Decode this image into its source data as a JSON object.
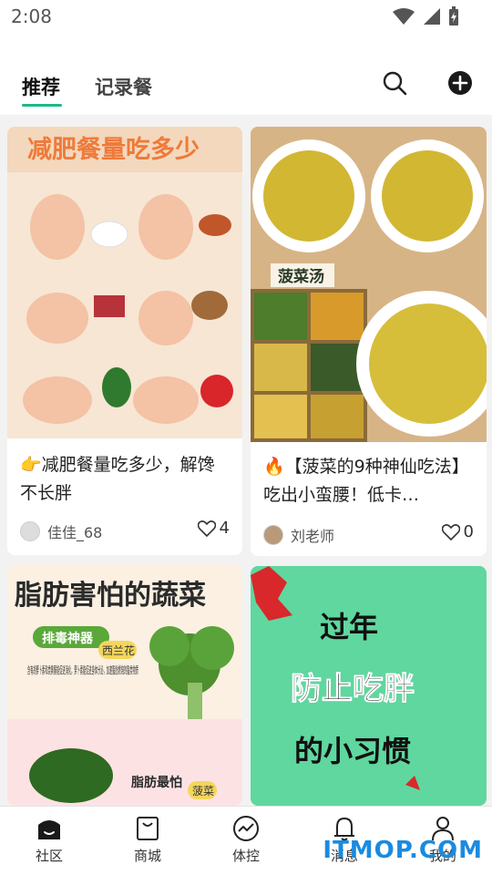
{
  "status": {
    "time": "2:08"
  },
  "tabs": [
    {
      "label": "推荐"
    },
    {
      "label": "记录餐"
    }
  ],
  "header": {
    "search_icon": "search-icon",
    "add_icon": "plus-circle-icon"
  },
  "cards": [
    {
      "image_text": "减肥餐量吃多少",
      "title": "👉减肥餐量吃多少，解馋不长胖",
      "author": "佳佳_68",
      "likes": "4"
    },
    {
      "image_text": "菠菜汤",
      "title": "🔥【菠菜的9种神仙吃法】吃出小蛮腰！低卡…",
      "author": "刘老师",
      "likes": "0"
    },
    {
      "image_text": "脂肪害怕的蔬菜",
      "image_sub": "排毒神器",
      "image_label1": "西兰花",
      "image_desc": "含有胡萝卜素和类黄酮能促进消化，萝卜素能促进身体分泌，加速脂肪燃烧的脂类物质",
      "image_sub2": "脂肪最怕",
      "image_label2": "菠菜"
    },
    {
      "image_line1": "过年",
      "image_line2": "防止吃胖",
      "image_line3": "的小习惯"
    }
  ],
  "nav": [
    {
      "label": "社区",
      "icon": "community-icon"
    },
    {
      "label": "商城",
      "icon": "shopping-bag-icon"
    },
    {
      "label": "体控",
      "icon": "trend-icon"
    },
    {
      "label": "消息",
      "icon": "bell-icon"
    },
    {
      "label": "我的",
      "icon": "user-icon"
    }
  ],
  "watermark": "ITMOP.COM",
  "colors": {
    "accent": "#1db88a"
  }
}
